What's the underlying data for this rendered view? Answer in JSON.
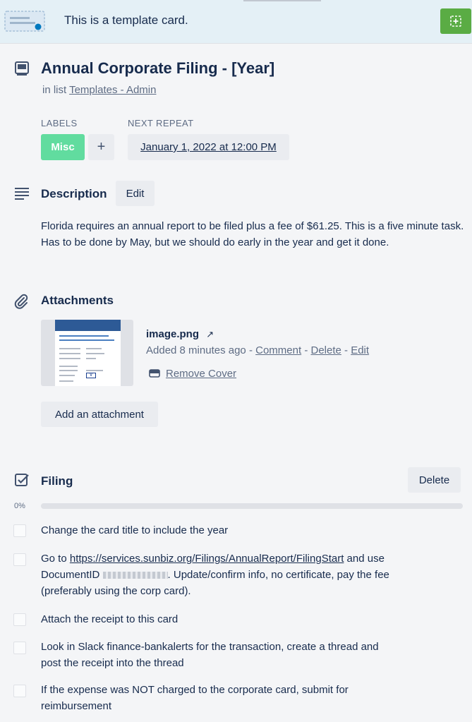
{
  "banner": {
    "text": "This is a template card.",
    "icon": "template-card-icon",
    "button_icon": "create-from-template-icon"
  },
  "card": {
    "title": "Annual Corporate Filing - [Year]",
    "in_list_prefix": "in list",
    "list_name": "Templates - Admin"
  },
  "labels": {
    "heading": "LABELS",
    "items": [
      {
        "name": "Misc",
        "color": "#61dc9f"
      }
    ],
    "add_label": "+"
  },
  "next_repeat": {
    "heading": "NEXT REPEAT",
    "value": "January 1, 2022 at 12:00 PM"
  },
  "description": {
    "heading": "Description",
    "edit_label": "Edit",
    "text": "Florida requires an annual report to be filed plus a fee of $61.25. This is a five minute task. Has to be done by May, but we should do early in the year and get it done."
  },
  "attachments": {
    "heading": "Attachments",
    "items": [
      {
        "name": "image.png",
        "open_icon": "↗",
        "added": "Added 8 minutes ago",
        "sep": " - ",
        "comment": "Comment",
        "delete": "Delete",
        "edit": "Edit",
        "remove_cover": "Remove Cover"
      }
    ],
    "add_label": "Add an attachment"
  },
  "checklist": {
    "title": "Filing",
    "delete_label": "Delete",
    "progress_label": "0%",
    "progress": 0,
    "items": [
      {
        "text": "Change the card title to include the year",
        "checked": false
      },
      {
        "prefix": "Go to ",
        "link": "https://services.sunbiz.org/Filings/AnnualReport/FilingStart",
        "mid": " and use DocumentID ",
        "suffix": ". Update/confirm info, no certificate, pay the fee (preferably using the corp card).",
        "checked": false
      },
      {
        "text": "Attach the receipt to this card",
        "checked": false
      },
      {
        "text": "Look in Slack finance-bankalerts for the transaction, create a thread and post the receipt into the thread",
        "checked": false
      },
      {
        "text": "If the expense was NOT charged to the corporate card, submit for reimbursement",
        "checked": false
      }
    ]
  },
  "colors": {
    "accent_green": "#5aac44",
    "banner_bg": "#e4f0f6",
    "text": "#172b4d",
    "muted": "#5e6c84"
  }
}
